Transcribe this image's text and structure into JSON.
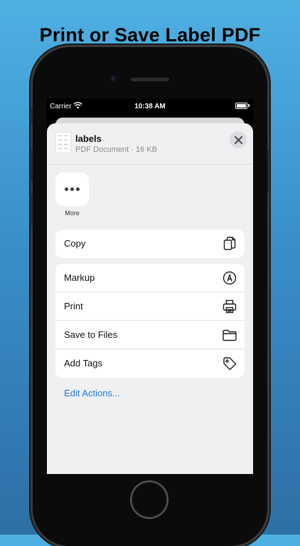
{
  "headline": "Print or Save Label PDF",
  "status_bar": {
    "carrier": "Carrier",
    "time": "10:38 AM"
  },
  "document": {
    "title": "labels",
    "meta": "PDF Document · 16 KB"
  },
  "app_tiles": [
    {
      "label": "More",
      "icon": "ellipsis-icon"
    }
  ],
  "action_groups": [
    [
      {
        "label": "Copy",
        "icon": "copy-icon"
      }
    ],
    [
      {
        "label": "Markup",
        "icon": "markup-icon"
      },
      {
        "label": "Print",
        "icon": "printer-icon"
      },
      {
        "label": "Save to Files",
        "icon": "folder-icon"
      },
      {
        "label": "Add Tags",
        "icon": "tag-icon"
      }
    ]
  ],
  "edit_actions_label": "Edit Actions...",
  "colors": {
    "link": "#1f7ae0",
    "sheet": "#f0f0f2",
    "background_top": "#4fb0e2",
    "background_bottom": "#2d6fa6"
  }
}
